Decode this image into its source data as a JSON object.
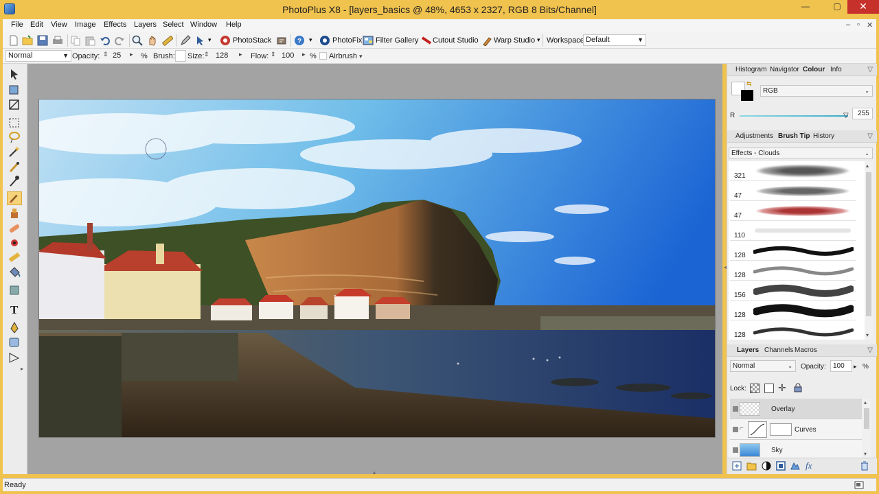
{
  "window": {
    "title": "PhotoPlus X8 - [layers_basics @ 48%, 4653 x 2327, RGB 8 Bits/Channel]",
    "minimize": "—",
    "restore": "▢",
    "close": "✕"
  },
  "menubar": {
    "items": [
      "File",
      "Edit",
      "View",
      "Image",
      "Effects",
      "Layers",
      "Select",
      "Window",
      "Help"
    ],
    "doc_controls": [
      "–",
      "▫",
      "✕"
    ]
  },
  "toolbar": {
    "photostack": "PhotoStack",
    "photofix": "PhotoFix",
    "filter_gallery": "Filter Gallery",
    "cutout_studio": "Cutout Studio",
    "warp_studio": "Warp Studio",
    "workspace_label": "Workspace",
    "workspace_value": "Default"
  },
  "contextbar": {
    "blend_mode": "Normal",
    "opacity_label": "Opacity:",
    "opacity_value": "25",
    "percent": "%",
    "brush_label": "Brush:",
    "size_label": "Size:",
    "size_value": "128",
    "flow_label": "Flow:",
    "flow_value": "100",
    "flow_percent": "%",
    "airbrush_label": "Airbrush"
  },
  "colour_panel": {
    "tabs": [
      "Histogram",
      "Navigator",
      "Colour",
      "Info"
    ],
    "active_tab": "Colour",
    "model": "RGB",
    "channel_label": "R",
    "channel_value": "255"
  },
  "brush_panel": {
    "tabs": [
      "Adjustments",
      "Brush Tip",
      "History"
    ],
    "active_tab": "Brush Tip",
    "category": "Effects - Clouds",
    "brushes": [
      {
        "size": "321",
        "style": "clouds-grey"
      },
      {
        "size": "47",
        "style": "clouds-grey"
      },
      {
        "size": "47",
        "style": "clouds-red"
      },
      {
        "size": "110",
        "style": "faint"
      },
      {
        "size": "128",
        "style": "dark-stroke"
      },
      {
        "size": "128",
        "style": "grey-stroke"
      },
      {
        "size": "156",
        "style": "dark-wide"
      },
      {
        "size": "128",
        "style": "dark-wide"
      },
      {
        "size": "128",
        "style": "dark-stroke"
      }
    ]
  },
  "layers_panel": {
    "tabs": [
      "Layers",
      "Channels",
      "Macros"
    ],
    "active_tab": "Layers",
    "blend_mode": "Normal",
    "opacity_label": "Opacity:",
    "opacity_value": "100",
    "percent": "%",
    "lock_label": "Lock:",
    "layers": [
      {
        "name": "Overlay",
        "type": "pixel"
      },
      {
        "name": "Curves",
        "type": "adjustment"
      },
      {
        "name": "Sky",
        "type": "image"
      }
    ],
    "fx_label": "fx"
  },
  "status": {
    "text": "Ready"
  },
  "colors": {
    "title_bar": "#f0c24e",
    "selection": "#f6d27a",
    "close_button": "#c7312b"
  }
}
